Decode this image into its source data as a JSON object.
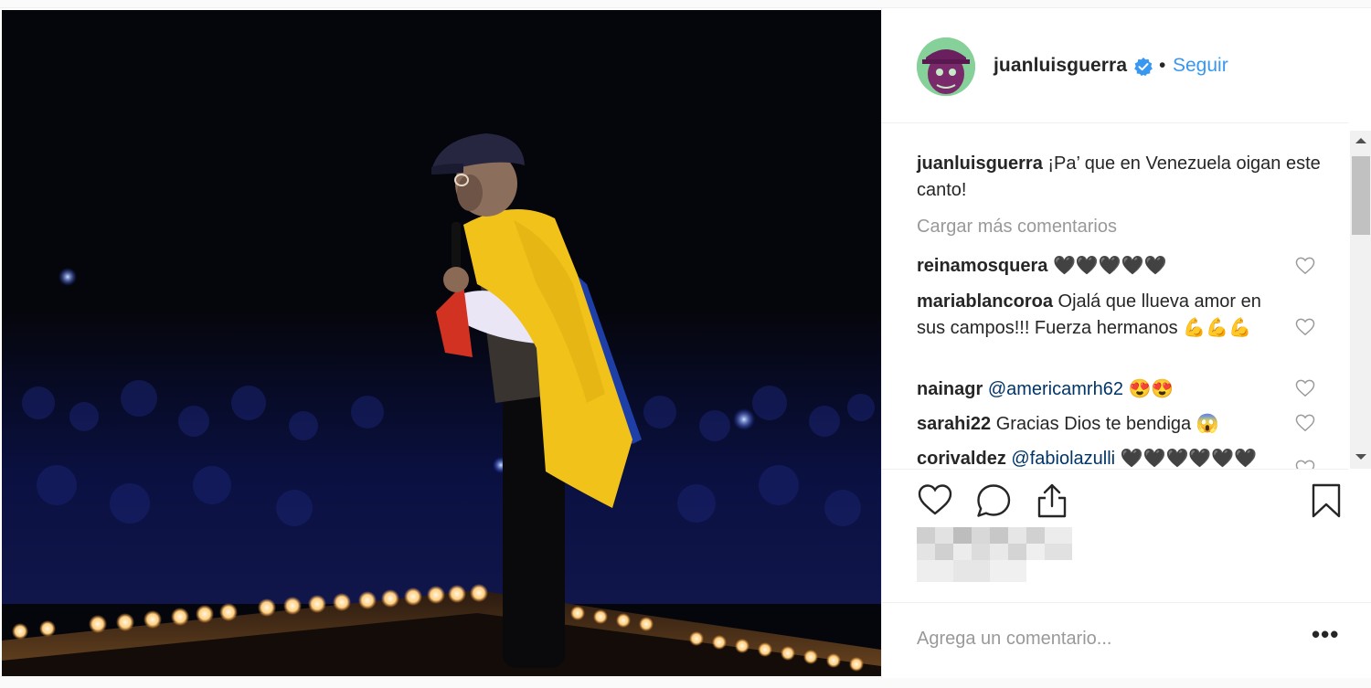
{
  "post": {
    "photo_alt": "",
    "author": {
      "username": "juanluisguerra",
      "verified": true,
      "separator": "•",
      "follow_label": "Seguir"
    },
    "caption": {
      "username": "juanluisguerra",
      "text": "¡Pa’ que en Venezuela oigan este canto!"
    },
    "load_more_label": "Cargar más comentarios",
    "comments": [
      {
        "username": "reinamosquera",
        "text": "🖤🖤🖤🖤🖤"
      },
      {
        "username": "mariablancoroa",
        "text": "Ojalá que llueva amor en sus campos!!! Fuerza hermanos 💪💪💪"
      },
      {
        "username": "nainagr",
        "mention": "@americamrh62",
        "text": " 😍😍"
      },
      {
        "username": "sarahi22",
        "text": "Gracias Dios te bendiga 😱"
      },
      {
        "username": "corivaldez",
        "mention": "@fabiolazulli",
        "text": " 🖤🖤🖤🖤🖤🖤"
      }
    ],
    "actions": {
      "like": "heart-icon",
      "comment": "comment-icon",
      "share": "share-icon",
      "save": "bookmark-icon"
    },
    "add_comment_placeholder": "Agrega un comentario...",
    "more_options": "•••",
    "colors": {
      "link": "#3897f0",
      "verified": "#3897f0",
      "text": "#262626",
      "muted": "#999999"
    }
  }
}
